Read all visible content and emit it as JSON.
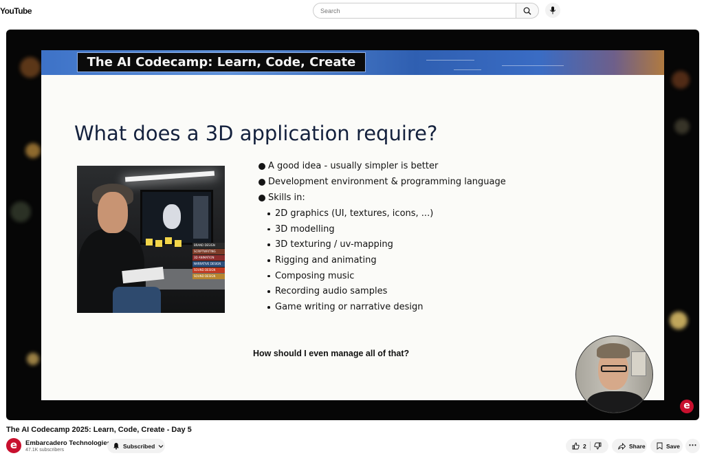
{
  "header": {
    "logo_text": "YouTube",
    "search_placeholder": "Search",
    "search_icon": "search-icon",
    "mic_icon": "mic-icon"
  },
  "slide": {
    "banner_title": "The AI Codecamp: Learn, Code, Create",
    "heading": "What does a 3D application require?",
    "bullets": [
      "A good idea - usually simpler is better",
      "Development environment & programming language",
      "Skills in:"
    ],
    "sub_bullets": [
      "2D graphics (UI, textures, icons, ...)",
      "3D modelling",
      "3D texturing / uv-mapping",
      "Rigging and animating",
      "Composing music",
      "Recording audio samples",
      "Game writing or narrative design"
    ],
    "question": "How should I even manage all of that?",
    "book_spines": [
      "BRAND DESIGN",
      "SCRIPTWRITING",
      "3D ANIMATION",
      "NARRATIVE DESIGN",
      "SOUND DESIGN",
      "SOUND DESIGN"
    ]
  },
  "video": {
    "title": "The AI Codecamp 2025: Learn, Code, Create - Day 5",
    "channel_initial": "e",
    "channel_name": "Embarcadero Technologies",
    "subscribers": "47.1K subscribers",
    "subscribe_label": "Subscribed",
    "like_count": "2",
    "share_label": "Share",
    "save_label": "Save",
    "more_label": "⋯"
  },
  "colors": {
    "brand_red": "#c8102e",
    "banner_blue": "#3d72c7",
    "slide_bg": "#fbfbf8",
    "heading_navy": "#14213d"
  }
}
